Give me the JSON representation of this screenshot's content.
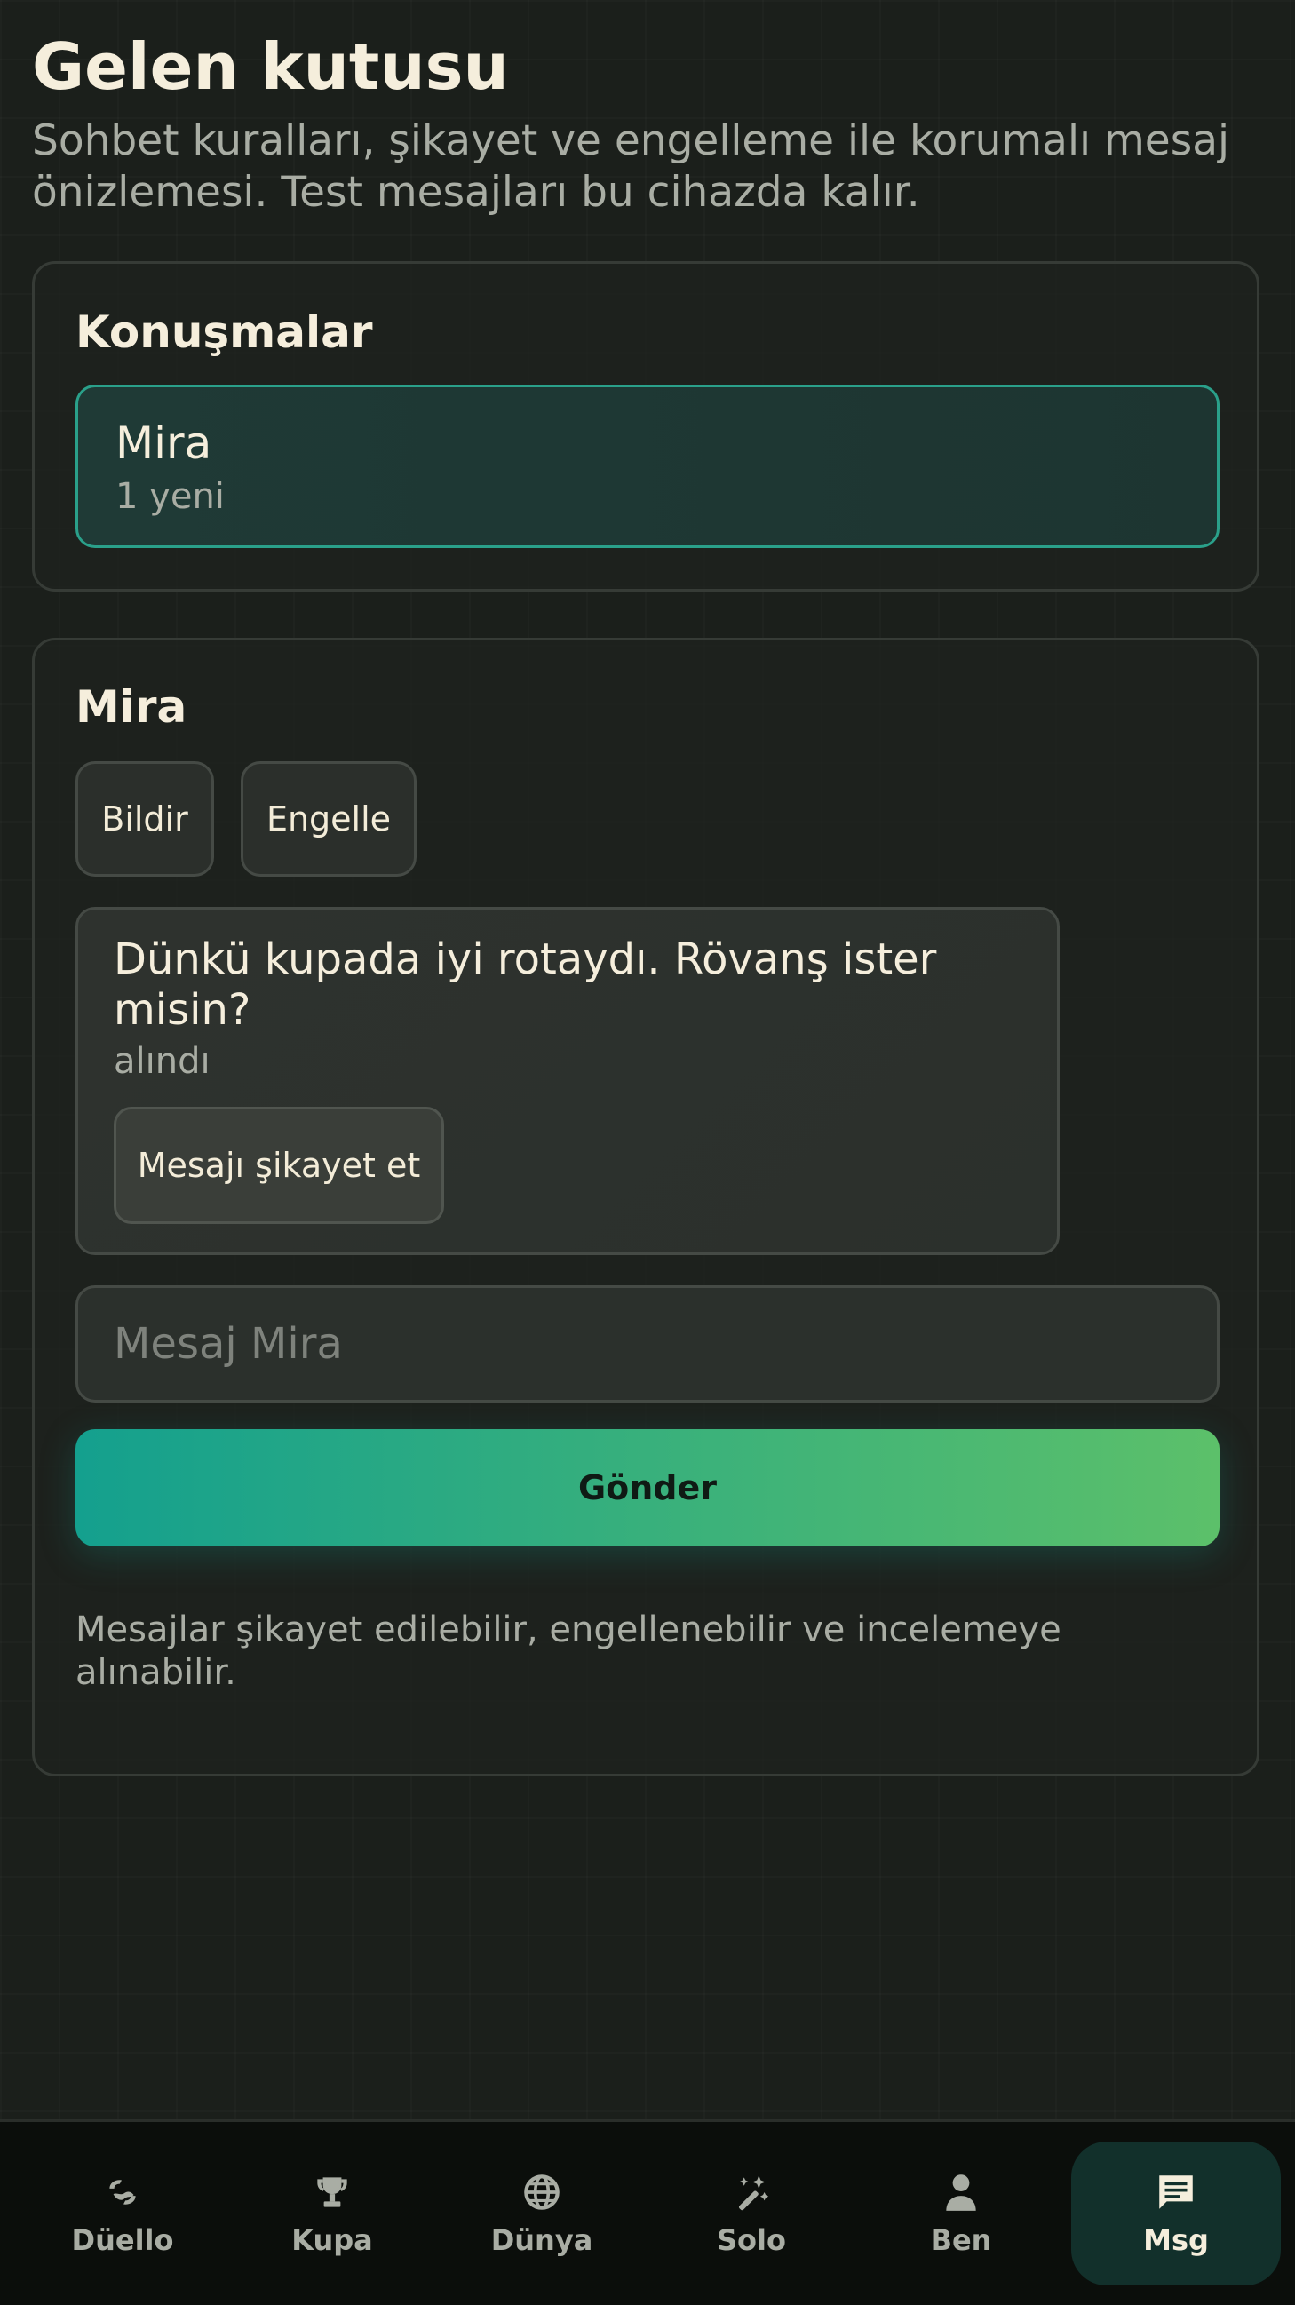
{
  "header": {
    "title": "Gelen kutusu",
    "subtitle": "Sohbet kuralları, şikayet ve engelleme ile korumalı mesaj önizlemesi. Test mesajları bu cihazda kalır."
  },
  "conversations": {
    "heading": "Konuşmalar",
    "items": [
      {
        "name": "Mira",
        "status": "1 yeni"
      }
    ]
  },
  "chat": {
    "heading": "Mira",
    "report_label": "Bildir",
    "block_label": "Engelle",
    "messages": [
      {
        "text": "Dünkü kupada iyi rotaydı. Rövanş ister misin?",
        "status": "alındı",
        "report_label": "Mesajı şikayet et"
      }
    ],
    "input": {
      "placeholder": "Mesaj Mira",
      "value": ""
    },
    "send_label": "Gönder",
    "note": "Mesajlar şikayet edilebilir, engellenebilir ve incelemeye alınabilir."
  },
  "tabbar": {
    "items": [
      {
        "label": "Düello",
        "icon": "duel-icon",
        "active": false
      },
      {
        "label": "Kupa",
        "icon": "trophy-icon",
        "active": false
      },
      {
        "label": "Dünya",
        "icon": "globe-icon",
        "active": false
      },
      {
        "label": "Solo",
        "icon": "wand-icon",
        "active": false
      },
      {
        "label": "Ben",
        "icon": "person-icon",
        "active": false
      },
      {
        "label": "Msg",
        "icon": "message-icon",
        "active": true
      }
    ]
  },
  "colors": {
    "background": "#1b1f1b",
    "accent_teal": "#14a08e",
    "accent_green": "#5cc06a",
    "text_primary": "#f5eedc",
    "text_muted": "#a9ada4"
  }
}
